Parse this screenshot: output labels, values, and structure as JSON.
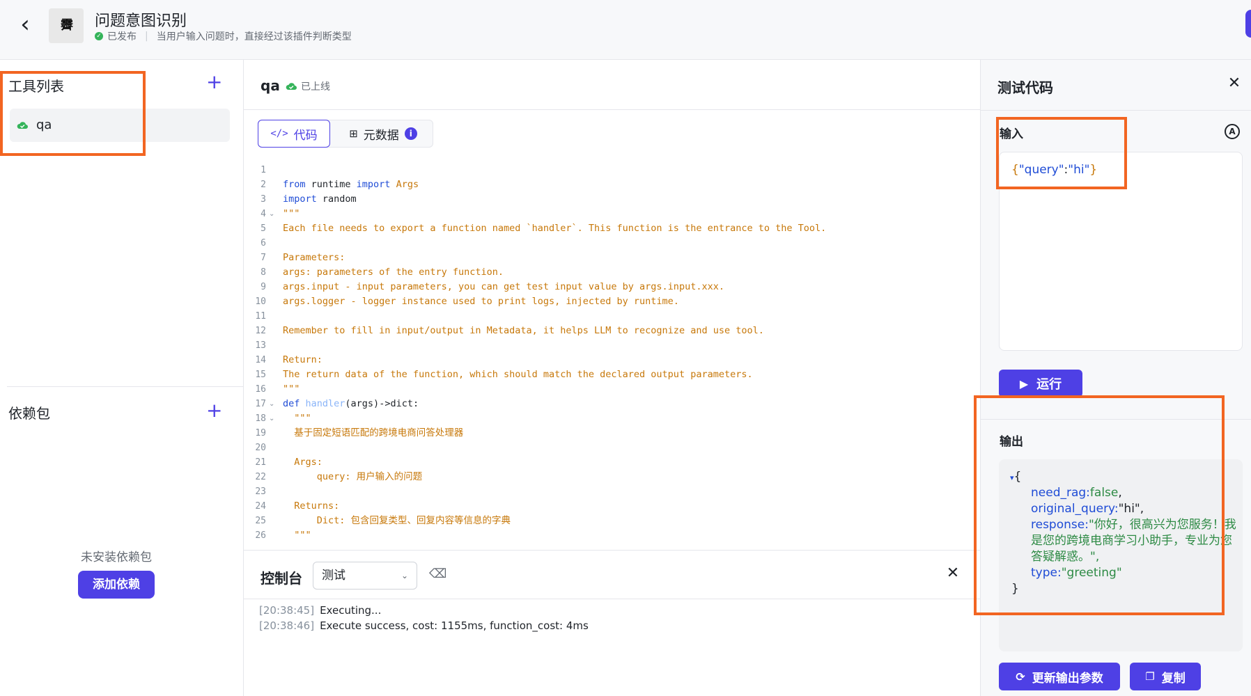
{
  "header": {
    "app_icon_text": "霽",
    "title": "问题意图识别",
    "status": "已发布",
    "description": "当用户输入问题时，直接经过该插件判断类型"
  },
  "left": {
    "tools_title": "工具列表",
    "tools": [
      {
        "label": "qa"
      }
    ],
    "deps_title": "依赖包",
    "deps_empty": "未安装依赖包",
    "deps_add_label": "添加依赖"
  },
  "editor": {
    "file_name": "qa",
    "file_status": "已上线",
    "tab_code": "代码",
    "tab_meta": "元数据",
    "meta_badge": "i",
    "lines": [
      {
        "n": "1",
        "t": ""
      },
      {
        "n": "2",
        "t": ""
      },
      {
        "n": "3",
        "t": ""
      },
      {
        "n": "4",
        "t": "\"\"\""
      },
      {
        "n": "5",
        "t": "Each file needs to export a function named `handler`. This function is the entrance to the Tool."
      },
      {
        "n": "6",
        "t": ""
      },
      {
        "n": "7",
        "t": "Parameters:"
      },
      {
        "n": "8",
        "t": "args: parameters of the entry function."
      },
      {
        "n": "9",
        "t": "args.input - input parameters, you can get test input value by args.input.xxx."
      },
      {
        "n": "10",
        "t": "args.logger - logger instance used to print logs, injected by runtime."
      },
      {
        "n": "11",
        "t": ""
      },
      {
        "n": "12",
        "t": "Remember to fill in input/output in Metadata, it helps LLM to recognize and use tool."
      },
      {
        "n": "13",
        "t": ""
      },
      {
        "n": "14",
        "t": "Return:"
      },
      {
        "n": "15",
        "t": "The return data of the function, which should match the declared output parameters."
      },
      {
        "n": "16",
        "t": "\"\"\""
      },
      {
        "n": "17",
        "t": ""
      },
      {
        "n": "18",
        "t": "  \"\"\""
      },
      {
        "n": "19",
        "t": "  基于固定短语匹配的跨境电商问答处理器"
      },
      {
        "n": "20",
        "t": ""
      },
      {
        "n": "21",
        "t": "  Args:"
      },
      {
        "n": "22",
        "t": "      query: 用户输入的问题"
      },
      {
        "n": "23",
        "t": ""
      },
      {
        "n": "24",
        "t": "  Returns:"
      },
      {
        "n": "25",
        "t": "      Dict: 包含回复类型、回复内容等信息的字典"
      },
      {
        "n": "26",
        "t": "  \"\"\""
      }
    ],
    "line2_from": "from",
    "line2_runtime": " runtime ",
    "line2_import": "import",
    "line2_args": " Args",
    "line3_import": "import",
    "line3_random": " random",
    "line17_def": "def",
    "line17_handler": " handler",
    "line17_rest": "(args)->dict:"
  },
  "console": {
    "title": "控制台",
    "select_value": "测试",
    "logs": [
      {
        "ts": "[20:38:45]",
        "msg": "Executing..."
      },
      {
        "ts": "[20:38:46]",
        "msg": "Execute success, cost: 1155ms, function_cost: 4ms"
      }
    ]
  },
  "right": {
    "title": "测试代码",
    "input_label": "输入",
    "input_ai_badge": "A",
    "input_json": {
      "open": "{",
      "key": "\"query\"",
      "colon": ":",
      "value": "\"hi\"",
      "close": "}"
    },
    "run_label": "运行",
    "output_label": "输出",
    "output": {
      "open": "{",
      "close": "}",
      "need_rag_key": "need_rag:",
      "need_rag_val": "false",
      "original_query_key": "original_query:",
      "original_query_val": "\"hi\"",
      "response_key": "response:",
      "response_l1": "\"你好，很高兴为您服务！我",
      "response_l2": "是您的跨境电商学习小助手，专业为您",
      "response_l3": "答疑解惑。\",",
      "type_key": "type:",
      "type_val": "\"greeting\""
    },
    "update_label": "更新输出参数",
    "copy_label": "复制"
  },
  "colors": {
    "accent": "#4e40e5",
    "annotation": "#f26522",
    "success": "#34b35a"
  }
}
